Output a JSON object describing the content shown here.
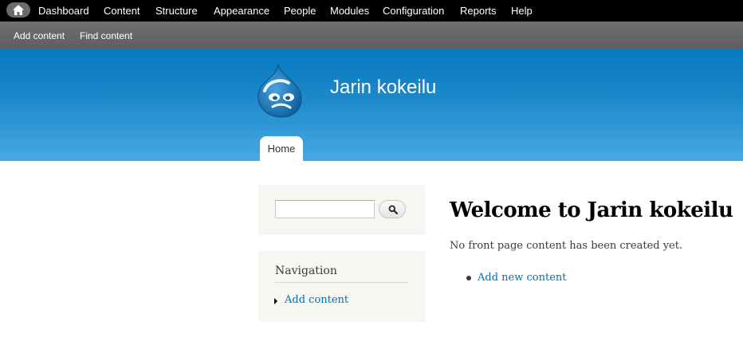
{
  "toolbar": {
    "home_icon": "home-icon",
    "items": [
      {
        "label": "Dashboard"
      },
      {
        "label": "Content"
      },
      {
        "label": "Structure"
      },
      {
        "label": "Appearance"
      },
      {
        "label": "People"
      },
      {
        "label": "Modules"
      },
      {
        "label": "Configuration"
      },
      {
        "label": "Reports"
      },
      {
        "label": "Help"
      }
    ]
  },
  "shortcuts": {
    "items": [
      {
        "label": "Add content"
      },
      {
        "label": "Find content"
      }
    ]
  },
  "header": {
    "logo_icon": "drupal-drop-logo",
    "site_name": "Jarin kokeilu",
    "tabs": [
      {
        "label": "Home",
        "active": true
      }
    ]
  },
  "sidebar": {
    "search": {
      "value": "",
      "button_icon": "search-icon"
    },
    "navigation": {
      "title": "Navigation",
      "links": [
        {
          "label": "Add content"
        }
      ]
    }
  },
  "main": {
    "title": "Welcome to Jarin kokeilu",
    "message": "No front page content has been created yet.",
    "links": [
      {
        "label": "Add new content"
      }
    ]
  },
  "colors": {
    "toolbar_bg": "#000000",
    "shortcut_bg": "#666666",
    "header_top": "#0779bf",
    "header_bottom": "#48a9e4",
    "link": "#0071b3",
    "block_bg": "#f6f6f2"
  }
}
